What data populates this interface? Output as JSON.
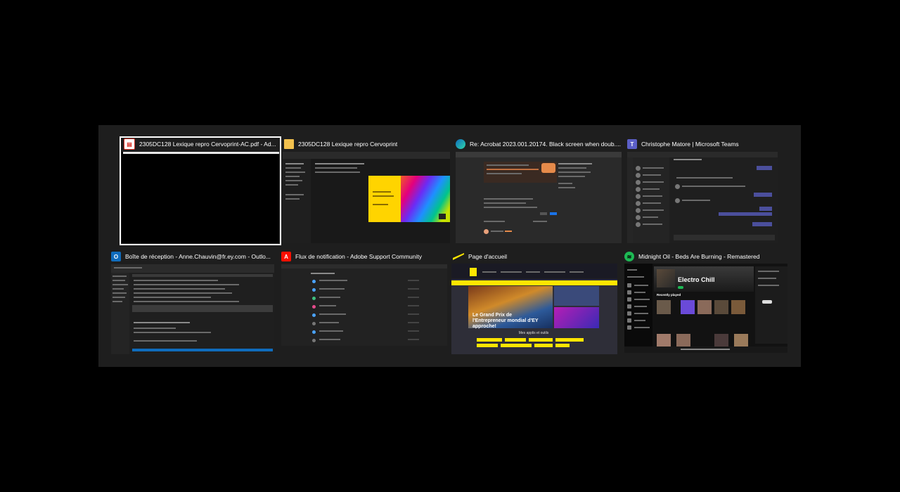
{
  "windows": [
    {
      "title": "2305DC128 Lexique repro Cervoprint-AC.pdf - Ad...",
      "icon": "pdf-file-icon",
      "selected": true
    },
    {
      "title": "2305DC128 Lexique repro Cervoprint",
      "icon": "folder-icon"
    },
    {
      "title": "Re: Acrobat 2023.001.20174. Black screen when doub....",
      "icon": "edge-browser-icon"
    },
    {
      "title": "Christophe Matore | Microsoft Teams",
      "icon": "teams-icon"
    },
    {
      "title": "Boîte de réception - Anne.Chauvin@fr.ey.com - Outlo...",
      "icon": "outlook-icon"
    },
    {
      "title": "Flux de notification - Adobe Support Community",
      "icon": "adobe-icon"
    },
    {
      "title": "Page d'accueil",
      "icon": "ey-logo-icon"
    },
    {
      "title": "Midnight Oil - Beds Are Burning - Remastered",
      "icon": "spotify-icon"
    }
  ],
  "previews": {
    "ey_hero_text": "Le Grand Prix de l'Entrepreneur mondial d'EY approche!",
    "ey_section_text": "Mes applis et outils",
    "spotify_playlist": "Electro Chill",
    "spotify_recent": "Recently played"
  },
  "colors": {
    "background": "#000000",
    "switcher_bg": "#1e1e1e",
    "ey_yellow": "#ffe600",
    "spotify_green": "#1db954",
    "teams_purple": "#5b5fc7",
    "outlook_blue": "#0f6cbd",
    "adobe_red": "#fa0f00"
  }
}
